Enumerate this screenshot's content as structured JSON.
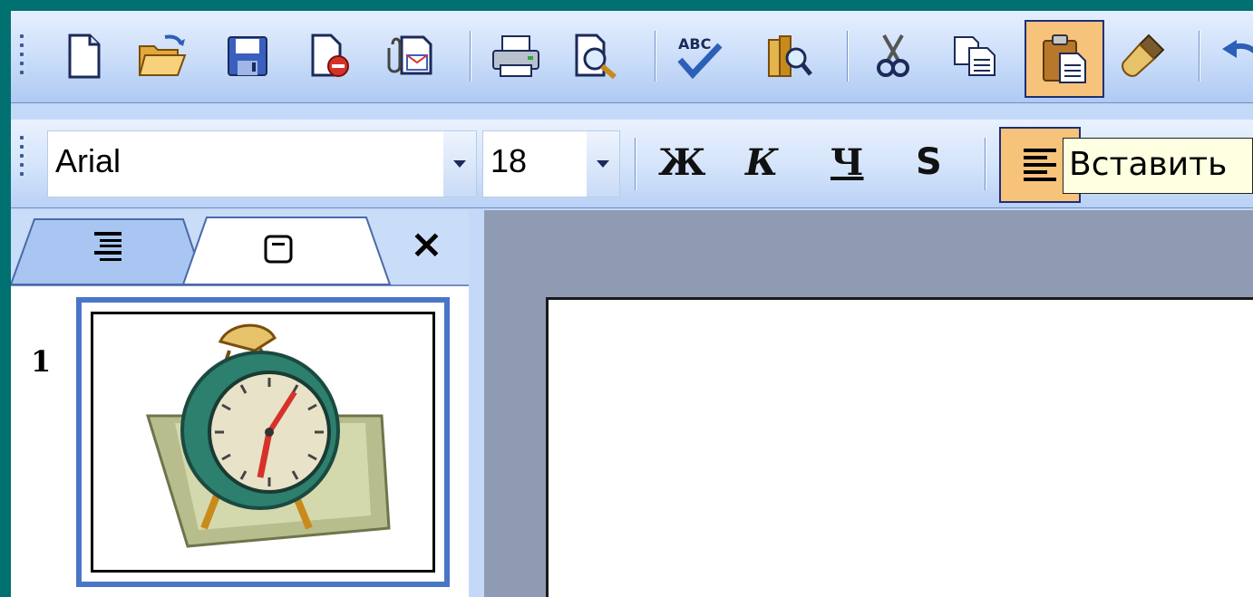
{
  "formatting": {
    "font_name": "Arial",
    "font_size": "18",
    "bold_glyph": "Ж",
    "italic_glyph": "К",
    "underline_glyph": "Ч",
    "shadow_glyph": "S"
  },
  "tooltip": {
    "text": "Вставить"
  },
  "side_pane": {
    "tabs": [
      "outline-tab",
      "slides-tab"
    ],
    "close_glyph": "×",
    "slides": [
      {
        "number": "1"
      }
    ]
  },
  "icons": {
    "standard_toolbar": [
      "new-icon",
      "open-icon",
      "save-icon",
      "permission-icon",
      "email-icon",
      "print-icon",
      "print-preview-icon",
      "spelling-icon",
      "research-icon",
      "cut-icon",
      "copy-icon",
      "paste-icon",
      "format-painter-icon",
      "undo-icon"
    ],
    "formatting_toolbar": [
      "align-left-icon"
    ]
  },
  "colors": {
    "desktop": "#007070",
    "toolbar": "#cfe0fa",
    "pressed_button": "#f7c27a",
    "thumb_border": "#4a76c7",
    "workspace": "#8e9bb3",
    "tooltip_bg": "#ffffe1"
  }
}
